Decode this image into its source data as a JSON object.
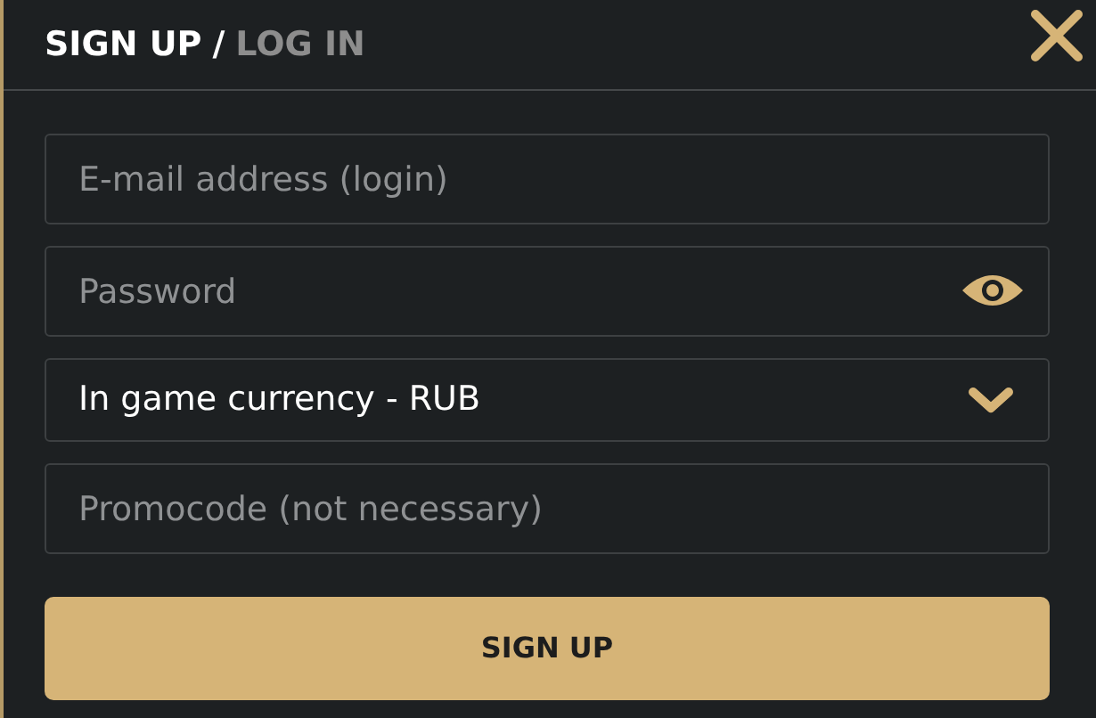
{
  "tabs": [
    {
      "label": "SIGN UP",
      "selected": true
    },
    {
      "label": "LOG IN",
      "selected": false
    }
  ],
  "tab_separator": "/",
  "fields": [
    {
      "kind": "text",
      "placeholder": "E-mail address (login)"
    },
    {
      "kind": "password",
      "placeholder": "Password"
    },
    {
      "kind": "select",
      "value": "In game currency - RUB"
    },
    {
      "kind": "text",
      "placeholder": "Promocode (not necessary)"
    }
  ],
  "submit_button": "SIGN UP"
}
